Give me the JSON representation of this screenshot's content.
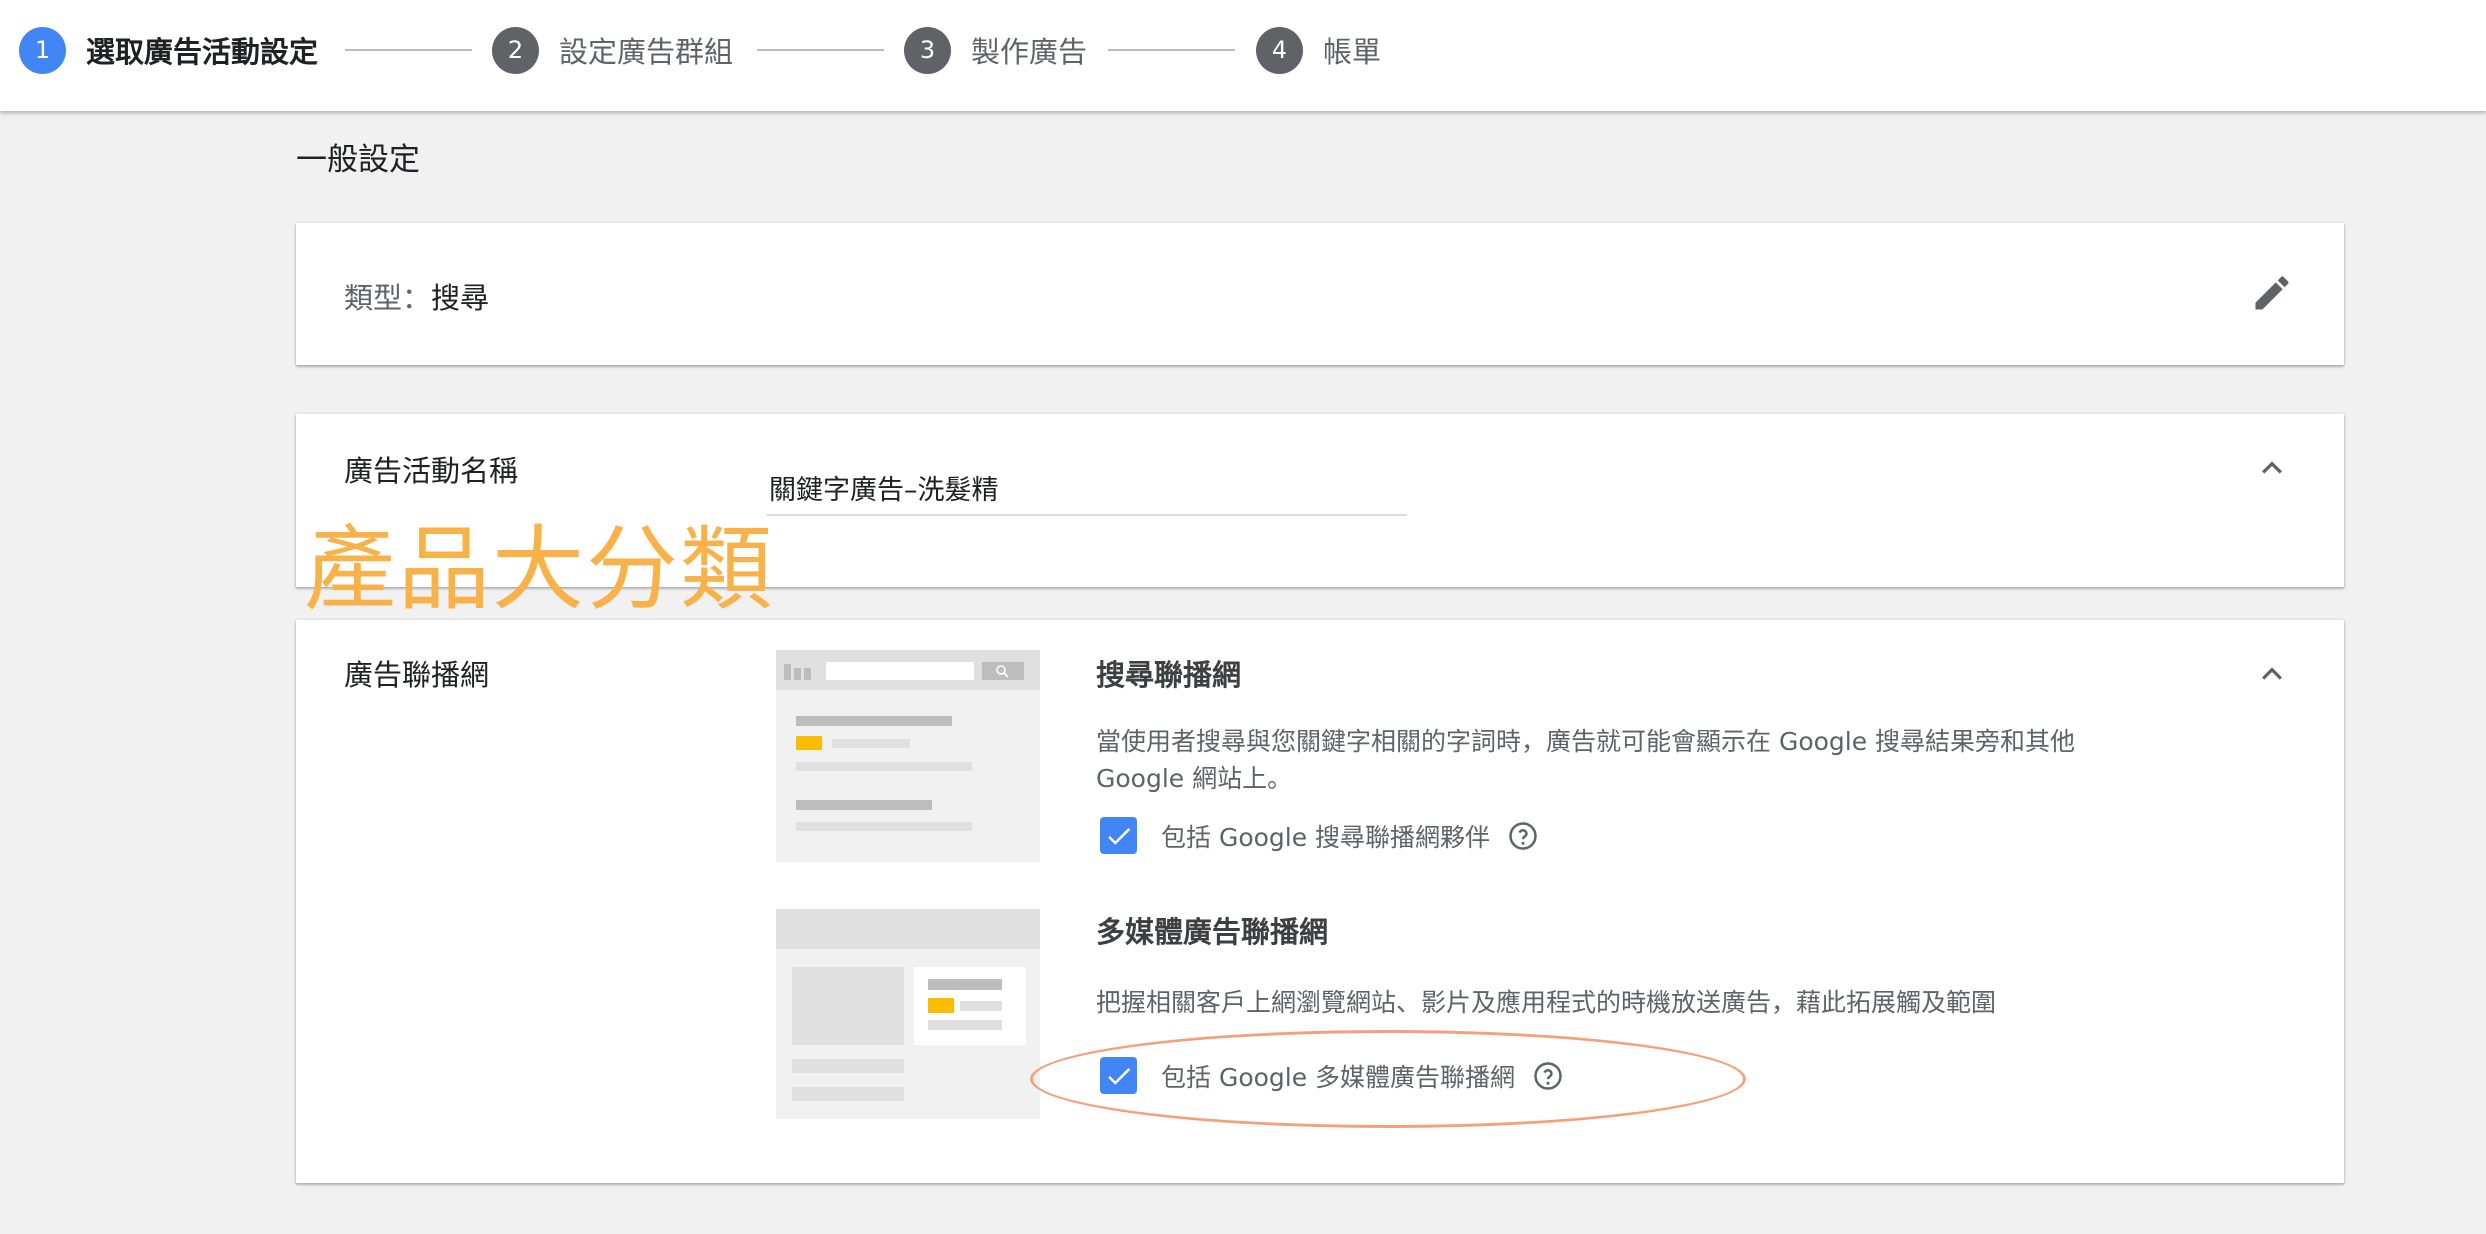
{
  "stepper": {
    "steps": [
      {
        "number": "1",
        "label": "選取廣告活動設定"
      },
      {
        "number": "2",
        "label": "設定廣告群組"
      },
      {
        "number": "3",
        "label": "製作廣告"
      },
      {
        "number": "4",
        "label": "帳單"
      }
    ],
    "active_step": 1
  },
  "general": {
    "title": "一般設定"
  },
  "type_card": {
    "label": "類型：",
    "value": "搜尋",
    "edit_icon": "pencil-icon"
  },
  "campaign_name": {
    "label": "廣告活動名稱",
    "value": "關鍵字廣告–洗髮精",
    "collapse_icon": "chevron-up-icon"
  },
  "overlay": {
    "annotation": "產品大分類"
  },
  "network": {
    "label": "廣告聯播網",
    "search": {
      "title": "搜尋聯播網",
      "description": "當使用者搜尋與您關鍵字相關的字詞時，廣告就可能會顯示在 Google 搜尋結果旁和其他 Google 網站上。",
      "checkbox_label": "包括 Google 搜尋聯播網夥伴",
      "checked": true
    },
    "display": {
      "title": "多媒體廣告聯播網",
      "description": "把握相關客戶上網瀏覽網站、影片及應用程式的時機放送廣告，藉此拓展觸及範圍",
      "checkbox_label": "包括 Google 多媒體廣告聯播網",
      "checked": true
    }
  },
  "colors": {
    "accent_blue": "#4285f4",
    "step_inactive": "#5f6368",
    "annotation_orange": "#f9b24a",
    "ellipse": "#f5a07a",
    "ad_highlight": "#fbbc04"
  }
}
